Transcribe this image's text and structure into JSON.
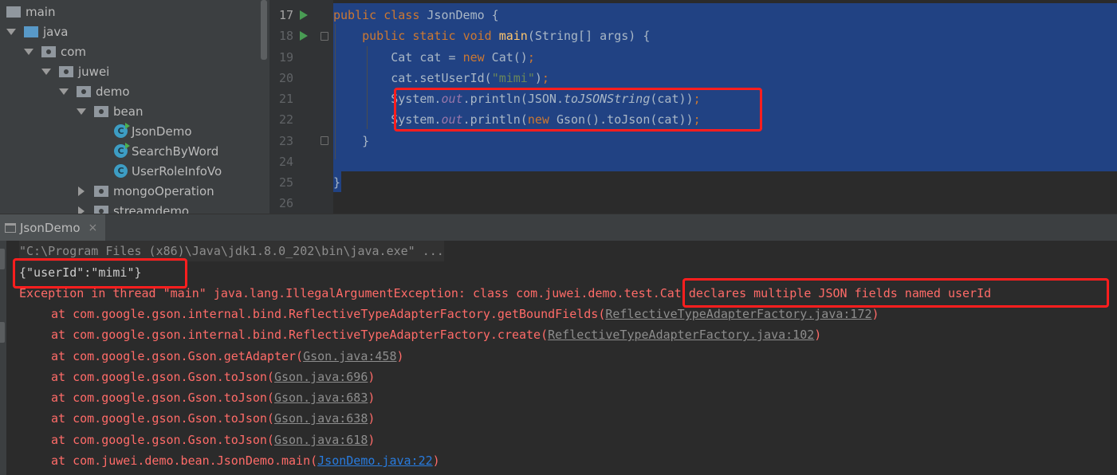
{
  "project_tree": {
    "items": [
      {
        "label": "main",
        "icon": "folder-icon",
        "expanded": true
      },
      {
        "label": "java",
        "icon": "source-folder-icon",
        "expanded": true
      },
      {
        "label": "com",
        "icon": "package-icon",
        "expanded": true
      },
      {
        "label": "juwei",
        "icon": "package-icon",
        "expanded": true
      },
      {
        "label": "demo",
        "icon": "package-icon",
        "expanded": true
      },
      {
        "label": "bean",
        "icon": "package-icon",
        "expanded": true
      },
      {
        "label": "JsonDemo",
        "icon": "class-runnable-icon"
      },
      {
        "label": "SearchByWord",
        "icon": "class-runnable-icon"
      },
      {
        "label": "UserRoleInfoVo",
        "icon": "class-icon"
      },
      {
        "label": "mongoOperation",
        "icon": "package-icon",
        "expanded": false
      },
      {
        "label": "streamdemo",
        "icon": "package-icon",
        "expanded": false
      }
    ]
  },
  "editor": {
    "line_numbers": [
      "17",
      "18",
      "19",
      "20",
      "21",
      "22",
      "23",
      "24",
      "25",
      "26"
    ],
    "current_line": "17",
    "code": {
      "l17": {
        "kw1": "public",
        "kw2": "class",
        "name": "JsonDemo",
        "rest": " {"
      },
      "l18": {
        "kw1": "public",
        "kw2": "static",
        "kw3": "void",
        "fn": "main",
        "rest": "(String[] args) {"
      },
      "l19": {
        "a": "Cat cat = ",
        "kw": "new",
        "b": " Cat()",
        "semi": ";"
      },
      "l20": {
        "a": "cat.setUserId(",
        "str": "\"mimi\"",
        "b": ")",
        "semi": ";"
      },
      "l21": {
        "a": "System.",
        "field": "out",
        "b": ".println(JSON.",
        "m": "toJSONString",
        "c": "(cat))",
        "semi": ";"
      },
      "l22": {
        "a": "System.",
        "field": "out",
        "b": ".println(",
        "kw": "new",
        "c": " Gson().toJson(cat))",
        "semi": ";"
      },
      "l23": {
        "a": "}"
      },
      "l25": {
        "a": "}"
      }
    }
  },
  "run_panel": {
    "tab_label": "JsonDemo",
    "tab_close": "×",
    "console": {
      "command": "\"C:\\Program Files (x86)\\Java\\jdk1.8.0_202\\bin\\java.exe\" ...",
      "output": "{\"userId\":\"mimi\"}",
      "exception": "Exception in thread \"main\" java.lang.IllegalArgumentException: class com.juwei.demo.test.Cat declares multiple JSON fields named userId",
      "trace": [
        {
          "text": "at com.google.gson.internal.bind.ReflectiveTypeAdapterFactory.getBoundFields(",
          "link": "ReflectiveTypeAdapterFactory.java:172",
          "close": ")"
        },
        {
          "text": "at com.google.gson.internal.bind.ReflectiveTypeAdapterFactory.create(",
          "link": "ReflectiveTypeAdapterFactory.java:102",
          "close": ")"
        },
        {
          "text": "at com.google.gson.Gson.getAdapter(",
          "link": "Gson.java:458",
          "close": ")"
        },
        {
          "text": "at com.google.gson.Gson.toJson(",
          "link": "Gson.java:696",
          "close": ")"
        },
        {
          "text": "at com.google.gson.Gson.toJson(",
          "link": "Gson.java:683",
          "close": ")"
        },
        {
          "text": "at com.google.gson.Gson.toJson(",
          "link": "Gson.java:638",
          "close": ")"
        },
        {
          "text": "at com.google.gson.Gson.toJson(",
          "link": "Gson.java:618",
          "close": ")"
        },
        {
          "text": "at com.juwei.demo.bean.JsonDemo.main(",
          "link": "JsonDemo.java:22",
          "close": ")"
        }
      ]
    }
  },
  "colors": {
    "annotation": "#ff1e1e",
    "selection": "#214283",
    "error_text": "#ff6b68",
    "keyword": "#cc7832",
    "string": "#6a8759",
    "static_field": "#9876aa"
  }
}
